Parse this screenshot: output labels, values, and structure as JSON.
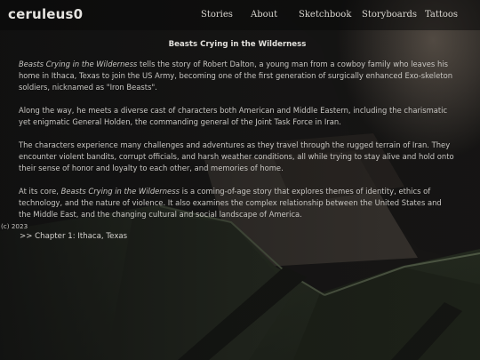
{
  "header": {
    "logo": "ceruleus0",
    "nav": [
      {
        "label": "Stories"
      },
      {
        "label": "About"
      },
      {
        "label": "Sketchbook"
      },
      {
        "label": "Storyboards"
      },
      {
        "label": "Tattoos"
      }
    ]
  },
  "main": {
    "title": "Beasts Crying in the Wilderness",
    "p1": {
      "em": "Beasts Crying in the Wilderness",
      "rest": " tells the story of Robert Dalton, a young man from a cowboy family who leaves his home in Ithaca, Texas to join the US Army, becoming one of the first generation of surgically enhanced Exo-skeleton soldiers, nicknamed as \"Iron Beasts\"."
    },
    "p2": "Along the way, he meets a diverse cast of characters both American and Middle Eastern, including the charismatic yet enigmatic General Holden, the commanding general of the Joint Task Force in Iran.",
    "p3": "The characters experience many challenges and adventures as they travel through the rugged terrain of Iran. They encounter violent bandits, corrupt officials, and harsh weather conditions, all while trying to stay alive and hold onto their sense of honor and loyalty to each other, and memories of home.",
    "p4": {
      "pre": "At its core, ",
      "em": "Beasts Crying in the Wilderness",
      "rest": " is a coming-of-age story that explores themes of identity, ethics of technology, and the nature of violence. It also examines the complex relationship between the United States and the Middle East, and the changing cultural and social landscape of America."
    }
  },
  "footer": {
    "copyright": "(c) 2023",
    "chapter_link": ">> Chapter 1: Ithaca, Texas"
  },
  "colors": {
    "background": "#141312",
    "text": "#c7c5c1",
    "accent_green": "#3b4a33"
  }
}
